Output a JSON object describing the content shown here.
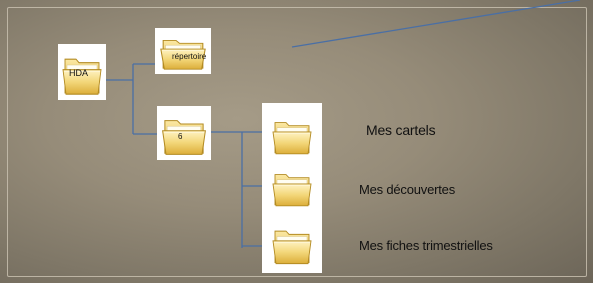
{
  "colors": {
    "connector": "#4a6fa5",
    "folder_fill": "#f3d77a",
    "folder_edge": "#b38b22"
  },
  "tree": {
    "root": {
      "name": "HDA",
      "icon": "folder-icon"
    },
    "children": [
      {
        "name": "répertoire",
        "icon": "folder-icon"
      },
      {
        "name": "6",
        "icon": "folder-icon",
        "children": [
          {
            "name": "",
            "icon": "folder-icon",
            "label": "Mes cartels"
          },
          {
            "name": "",
            "icon": "folder-icon",
            "label": "Mes découvertes"
          },
          {
            "name": "",
            "icon": "folder-icon",
            "label": "Mes fiches trimestrielles"
          }
        ]
      }
    ]
  }
}
